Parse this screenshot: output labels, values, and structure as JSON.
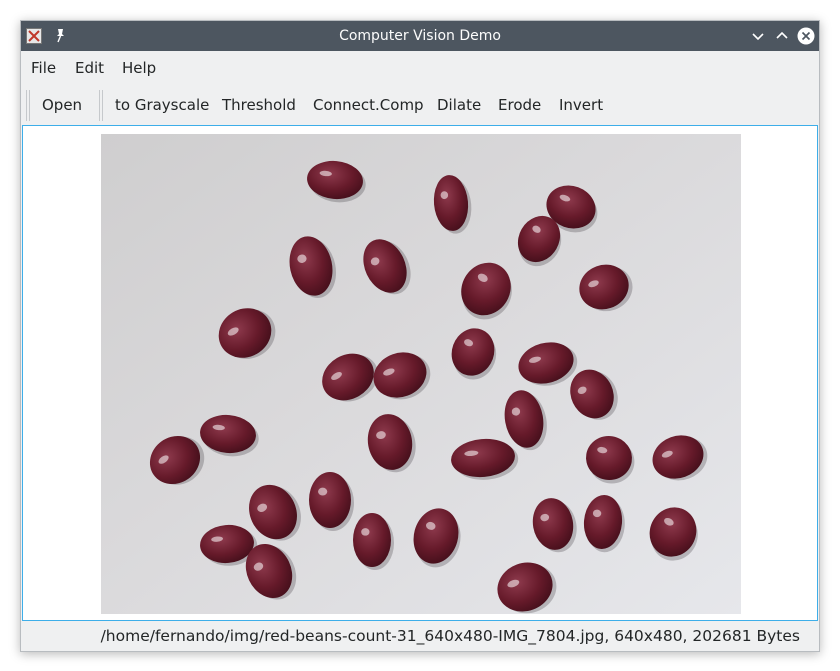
{
  "window": {
    "title": "Computer Vision Demo",
    "controls": [
      "minimize-icon",
      "maximize-icon",
      "close-icon"
    ]
  },
  "menubar": {
    "items": [
      {
        "label": "File"
      },
      {
        "label": "Edit"
      },
      {
        "label": "Help"
      }
    ]
  },
  "toolbar": {
    "open_label": "Open",
    "actions": [
      {
        "label": "to Grayscale"
      },
      {
        "label": "Threshold"
      },
      {
        "label": "Connect.Comp"
      },
      {
        "label": "Dilate"
      },
      {
        "label": "Erode"
      },
      {
        "label": "Invert"
      }
    ]
  },
  "image": {
    "subject": "photo of red kidney beans on a white plate"
  },
  "statusbar": {
    "text": "/home/fernando/img/red-beans-count-31_640x480-IMG_7804.jpg, 640x480, 202681 Bytes"
  },
  "colors": {
    "titlebar": "#4d5660",
    "window_bg": "#eff0f1",
    "focus_border": "#3daee9",
    "bean": "#6b1b2c"
  }
}
